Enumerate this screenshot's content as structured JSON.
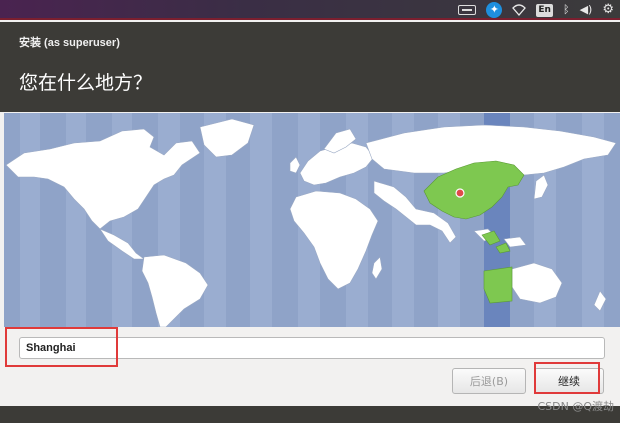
{
  "top_panel": {
    "indicators": [
      {
        "name": "keyboard-icon"
      },
      {
        "name": "accessibility-icon",
        "glyph": "✦"
      },
      {
        "name": "wifi-icon",
        "glyph": "◇"
      },
      {
        "name": "input-language",
        "label": "En"
      },
      {
        "name": "bluetooth-icon",
        "glyph": "ᛒ"
      },
      {
        "name": "volume-icon",
        "glyph": "◀)"
      },
      {
        "name": "settings-gear-icon",
        "glyph": "⚙"
      }
    ]
  },
  "window": {
    "title": "安装 (as superuser)",
    "page_title": "您在什么地方？"
  },
  "map": {
    "ocean_color": "#8fa3c8",
    "land_color": "#ffffff",
    "selected_zone_color": "#7ec850",
    "selected_band_color": "#6a85bd",
    "selected_city": "Shanghai"
  },
  "form": {
    "timezone_value": "Shanghai"
  },
  "buttons": {
    "back": "后退(B)",
    "continue": "继续"
  },
  "watermark": "CSDN @Q渡劫"
}
